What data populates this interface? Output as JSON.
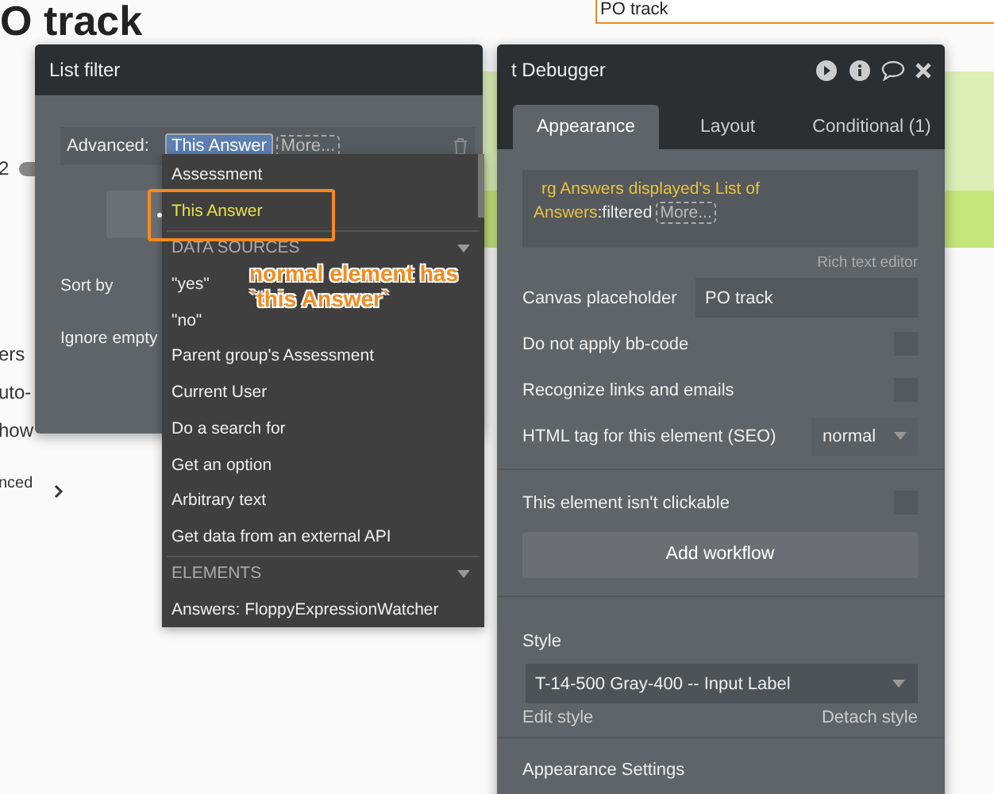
{
  "canvas": {
    "heading": "O track",
    "number": "2",
    "toggle_on": false,
    "fragments": [
      "ers",
      "uto-",
      "how"
    ],
    "advanced_link": "nced",
    "top_field": "PO track"
  },
  "list_filter": {
    "title": "List filter",
    "advanced_label": "Advanced:",
    "advanced_value": "This Answer",
    "more": "More...",
    "sort_by": "Sort by",
    "ignore_empty": "Ignore empty"
  },
  "dropdown": {
    "items": [
      {
        "kind": "option",
        "label": "Assessment",
        "selected": false
      },
      {
        "kind": "option",
        "label": "This Answer",
        "selected": true
      },
      {
        "kind": "section",
        "label": "DATA SOURCES"
      },
      {
        "kind": "option",
        "label": "\"yes\"",
        "selected": false
      },
      {
        "kind": "option",
        "label": "\"no\"",
        "selected": false
      },
      {
        "kind": "option",
        "label": "Parent group's Assessment",
        "selected": false
      },
      {
        "kind": "option",
        "label": "Current User",
        "selected": false
      },
      {
        "kind": "option",
        "label": "Do a search for",
        "selected": false
      },
      {
        "kind": "option",
        "label": "Get an option",
        "selected": false
      },
      {
        "kind": "option",
        "label": "Arbitrary text",
        "selected": false
      },
      {
        "kind": "option",
        "label": "Get data from an external API",
        "selected": false
      },
      {
        "kind": "section",
        "label": "ELEMENTS"
      },
      {
        "kind": "option",
        "label": "Answers: FloppyExpressionWatcher",
        "selected": false
      }
    ]
  },
  "annotation": {
    "lines": [
      "normal element has",
      "`this Answer`"
    ]
  },
  "debugger": {
    "title": "t Debugger",
    "tabs": [
      {
        "label": "Appearance",
        "selected": true
      },
      {
        "label": "Layout",
        "selected": false
      },
      {
        "label": "Conditional (1)",
        "selected": false
      }
    ],
    "expression": {
      "dynamic": "rg Answers displayed's List of Answers",
      "operator": ":filtered",
      "more": "More..."
    },
    "rich_text_editor": "Rich text editor",
    "rows": [
      {
        "kind": "input",
        "label": "Canvas placeholder",
        "value": "PO track"
      },
      {
        "kind": "checkbox",
        "label": "Do not apply bb-code",
        "checked": false
      },
      {
        "kind": "checkbox",
        "label": "Recognize links and emails",
        "checked": false
      },
      {
        "kind": "select",
        "label": "HTML tag for this element (SEO)",
        "value": "normal"
      }
    ],
    "clickable": {
      "label": "This element isn't clickable",
      "checked": false
    },
    "add_workflow": "Add workflow",
    "style": {
      "label": "Style",
      "value": "T-14-500 Gray-400 -- Input Label",
      "edit": "Edit style",
      "detach": "Detach style"
    },
    "appearance_settings": "Appearance Settings"
  }
}
